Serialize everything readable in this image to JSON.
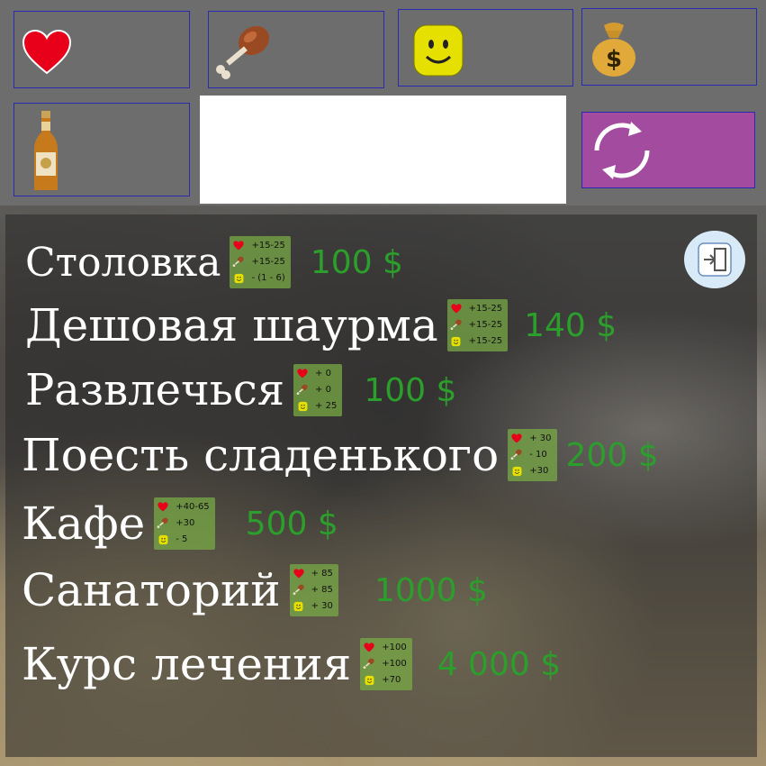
{
  "top_slots": {
    "health": {
      "icon": "heart-icon"
    },
    "food": {
      "icon": "drumstick-icon"
    },
    "mood": {
      "icon": "smiley-icon"
    },
    "money": {
      "icon": "money-bag-icon"
    },
    "drink": {
      "icon": "beer-bottle-icon"
    },
    "refresh": {
      "icon": "refresh-icon"
    }
  },
  "menu": [
    {
      "name": "Столовка",
      "stats": [
        "+15-25",
        "+15-25",
        "- (1 - 6)"
      ],
      "price": "100 $"
    },
    {
      "name": "Дешовая шаурма",
      "stats": [
        "+15-25",
        "+15-25",
        "+15-25"
      ],
      "price": "140 $"
    },
    {
      "name": "Развлечься",
      "stats": [
        "+ 0",
        "+ 0",
        "+ 25"
      ],
      "price": "100 $"
    },
    {
      "name": "Поесть сладенького",
      "stats": [
        "+ 30",
        "- 10",
        "+30"
      ],
      "price": "200 $"
    },
    {
      "name": "Кафе",
      "stats": [
        "+40-65",
        "+30",
        "- 5"
      ],
      "price": "500 $"
    },
    {
      "name": "Санаторий",
      "stats": [
        "+ 85",
        "+ 85",
        "+ 30"
      ],
      "price": "1000 $"
    },
    {
      "name": "Курс лечения",
      "stats": [
        "+100",
        "+100",
        "+70"
      ],
      "price": "4 000 $"
    }
  ],
  "colors": {
    "price": "#2c9e2c",
    "refresh_bg": "#a24b9f",
    "slot_border": "#2a2ab0"
  }
}
